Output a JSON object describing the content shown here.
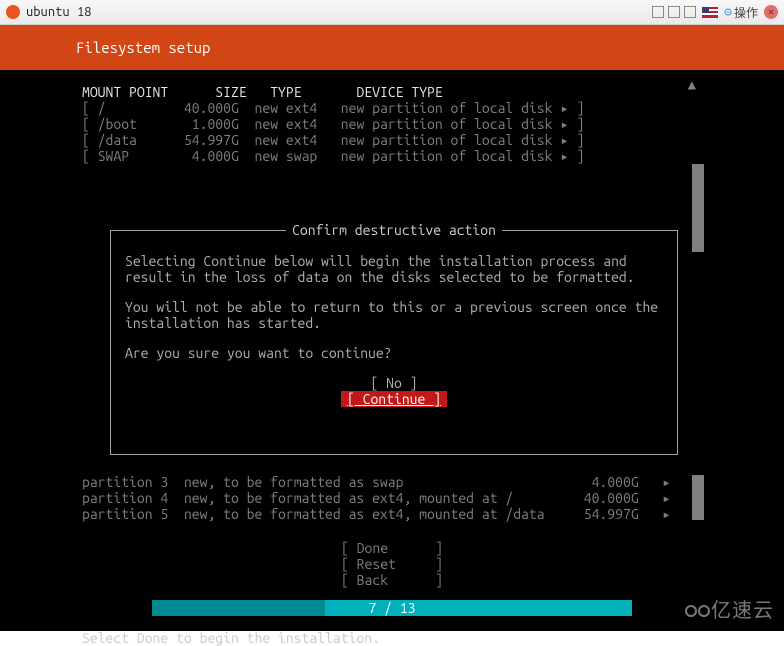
{
  "titlebar": {
    "title": "ubuntu 18",
    "op_label": "操作"
  },
  "header": {
    "title": "Filesystem setup"
  },
  "table": {
    "columns": {
      "mount": "MOUNT POINT",
      "size": "SIZE",
      "type": "TYPE",
      "devtype": "DEVICE TYPE"
    },
    "rows": [
      {
        "mount": "/",
        "size": "40.000G",
        "type": "new ext4",
        "devtype": "new partition of local disk"
      },
      {
        "mount": "/boot",
        "size": "1.000G",
        "type": "new ext4",
        "devtype": "new partition of local disk"
      },
      {
        "mount": "/data",
        "size": "54.997G",
        "type": "new ext4",
        "devtype": "new partition of local disk"
      },
      {
        "mount": "SWAP",
        "size": "4.000G",
        "type": "new swap",
        "devtype": "new partition of local disk"
      }
    ]
  },
  "dialog": {
    "title": "Confirm destructive action",
    "p1": "Selecting Continue below will begin the installation process and result in the loss of data on the disks selected to be formatted.",
    "p2": "You will not be able to return to this or a previous screen once the installation has started.",
    "p3": "Are you sure you want to continue?",
    "no": "No",
    "continue": "Continue"
  },
  "partitions": [
    {
      "label": "partition 3",
      "desc": "new, to be formatted as swap",
      "size": "4.000G"
    },
    {
      "label": "partition 4",
      "desc": "new, to be formatted as ext4, mounted at /",
      "size": "40.000G"
    },
    {
      "label": "partition 5",
      "desc": "new, to be formatted as ext4, mounted at /data",
      "size": "54.997G"
    }
  ],
  "actions": {
    "done": "Done",
    "reset": "Reset",
    "back": "Back"
  },
  "progress": {
    "text": "7 / 13"
  },
  "footer": "Select Done to begin the installation.",
  "watermark": "亿速云"
}
